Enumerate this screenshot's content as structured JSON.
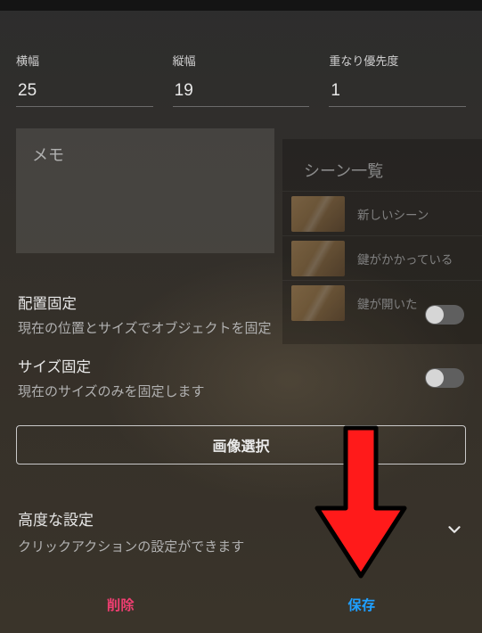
{
  "fields": {
    "width": {
      "label": "横幅",
      "value": "25"
    },
    "height": {
      "label": "縦幅",
      "value": "19"
    },
    "zindex": {
      "label": "重なり優先度",
      "value": "1"
    }
  },
  "memo": {
    "placeholder": "メモ"
  },
  "scene_panel": {
    "title": "シーン一覧",
    "items": [
      {
        "label": "新しいシーン"
      },
      {
        "label": "鍵がかかっている"
      },
      {
        "label": "鍵が開いた"
      }
    ]
  },
  "settings": {
    "lock_position": {
      "title": "配置固定",
      "desc": "現在の位置とサイズでオブジェクトを固定",
      "on": false
    },
    "lock_size": {
      "title": "サイズ固定",
      "desc": "現在のサイズのみを固定します",
      "on": false
    }
  },
  "buttons": {
    "image_select": "画像選択",
    "delete": "削除",
    "save": "保存"
  },
  "advanced": {
    "title": "高度な設定",
    "desc": "クリックアクションの設定ができます"
  },
  "colors": {
    "delete": "#ef3e71",
    "save": "#1f9fff",
    "arrow": "#ff1a1a"
  }
}
